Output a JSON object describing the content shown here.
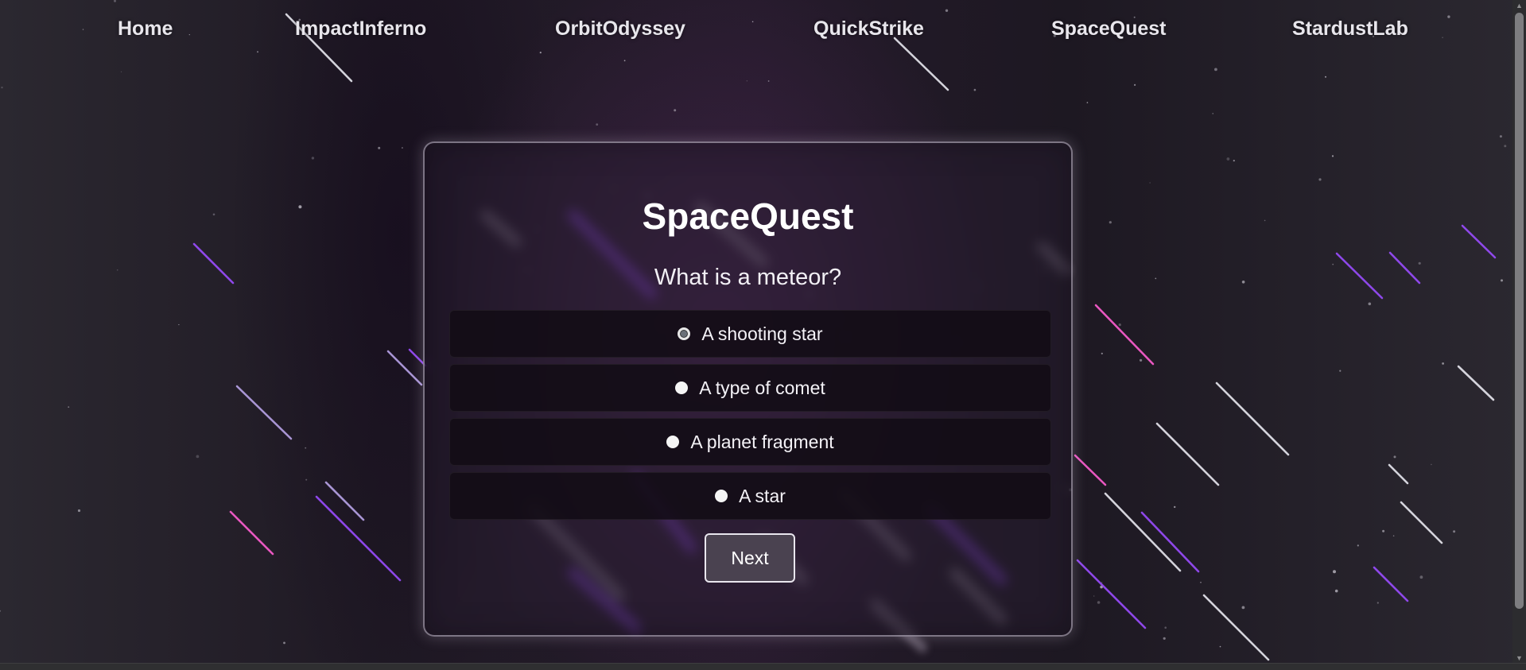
{
  "nav": {
    "items": [
      {
        "label": "Home"
      },
      {
        "label": "ImpactInferno"
      },
      {
        "label": "OrbitOdyssey"
      },
      {
        "label": "QuickStrike"
      },
      {
        "label": "SpaceQuest"
      },
      {
        "label": "StardustLab"
      }
    ]
  },
  "quiz": {
    "title": "SpaceQuest",
    "question": "What is a meteor?",
    "options": [
      {
        "label": "A shooting star",
        "selected": true
      },
      {
        "label": "A type of comet",
        "selected": false
      },
      {
        "label": "A planet fragment",
        "selected": false
      },
      {
        "label": "A star",
        "selected": false
      }
    ],
    "next_label": "Next"
  },
  "colors": {
    "background": "#26222a",
    "card_border": "#c8c3d2",
    "meteor_purple": "#9b4dff",
    "meteor_pink": "#ff5fd2",
    "meteor_white": "#e8e8f0"
  }
}
